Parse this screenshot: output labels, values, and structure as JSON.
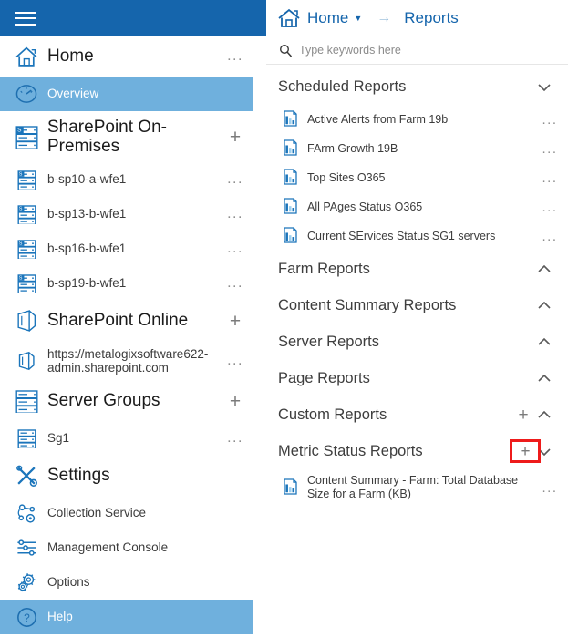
{
  "sidebar": {
    "menu_icon": "hamburger-icon",
    "items": [
      {
        "id": "home",
        "label": "Home",
        "icon": "home-icon",
        "type": "top",
        "action": "...",
        "selected": false
      },
      {
        "id": "overview",
        "label": "Overview",
        "icon": "gauge-icon",
        "type": "child",
        "action": "",
        "selected": true
      },
      {
        "id": "sp-onprem",
        "label": "SharePoint On-Premises",
        "icon": "server-sp-icon",
        "type": "group-two",
        "action": "+",
        "selected": false
      },
      {
        "id": "b-sp10-a-wfe1",
        "label": "b-sp10-a-wfe1",
        "icon": "server-sp-small-icon",
        "type": "child",
        "action": "...",
        "selected": false
      },
      {
        "id": "b-sp13-b-wfe1",
        "label": "b-sp13-b-wfe1",
        "icon": "server-sp-small-icon",
        "type": "child",
        "action": "...",
        "selected": false
      },
      {
        "id": "b-sp16-b-wfe1",
        "label": "b-sp16-b-wfe1",
        "icon": "server-sp-small-icon",
        "type": "child",
        "action": "...",
        "selected": false
      },
      {
        "id": "b-sp19-b-wfe1",
        "label": "b-sp19-b-wfe1",
        "icon": "server-sp-small-icon",
        "type": "child",
        "action": "...",
        "selected": false
      },
      {
        "id": "sp-online",
        "label": "SharePoint Online",
        "icon": "sharepoint-online-icon",
        "type": "group",
        "action": "+",
        "selected": false
      },
      {
        "id": "sp-online-tenant",
        "label": "https://metalogixsoftware622-admin.sharepoint.com",
        "icon": "sharepoint-online-small-icon",
        "type": "child-two",
        "action": "...",
        "selected": false
      },
      {
        "id": "server-groups",
        "label": "Server Groups",
        "icon": "server-group-icon",
        "type": "group",
        "action": "+",
        "selected": false
      },
      {
        "id": "sg1",
        "label": "Sg1",
        "icon": "server-small-icon",
        "type": "child",
        "action": "...",
        "selected": false
      },
      {
        "id": "settings",
        "label": "Settings",
        "icon": "tools-icon",
        "type": "group",
        "action": "",
        "selected": false
      },
      {
        "id": "collection-service",
        "label": "Collection Service",
        "icon": "network-node-icon",
        "type": "child",
        "action": "",
        "selected": false
      },
      {
        "id": "management-console",
        "label": "Management Console",
        "icon": "sliders-icon",
        "type": "child",
        "action": "",
        "selected": false
      },
      {
        "id": "options",
        "label": "Options",
        "icon": "gears-icon",
        "type": "child",
        "action": "",
        "selected": false
      },
      {
        "id": "help",
        "label": "Help",
        "icon": "question-circle-icon",
        "type": "child",
        "action": "",
        "selected": true
      }
    ]
  },
  "breadcrumb": {
    "home_icon": "home-icon",
    "home_label": "Home",
    "dropdown_caret": "caret-down-icon",
    "separator": "arrow-right-icon",
    "current": "Reports"
  },
  "search": {
    "icon": "search-icon",
    "placeholder": "Type keywords here",
    "value": ""
  },
  "reports": {
    "sections": [
      {
        "id": "scheduled-reports",
        "title": "Scheduled Reports",
        "expanded": true,
        "chevron": "chevron-down-icon",
        "has_add": false,
        "add_highlighted": false,
        "items": [
          {
            "label": "Active Alerts from Farm 19b",
            "icon": "report-chart-icon",
            "action": "..."
          },
          {
            "label": "FArm Growth 19B",
            "icon": "report-chart-icon",
            "action": "..."
          },
          {
            "label": "Top Sites O365",
            "icon": "report-chart-icon",
            "action": "..."
          },
          {
            "label": "All PAges Status O365",
            "icon": "report-chart-icon",
            "action": "..."
          },
          {
            "label": "Current SErvices Status SG1 servers",
            "icon": "report-chart-icon",
            "action": "..."
          }
        ]
      },
      {
        "id": "farm-reports",
        "title": "Farm Reports",
        "expanded": false,
        "chevron": "chevron-up-icon",
        "has_add": false,
        "add_highlighted": false,
        "items": []
      },
      {
        "id": "content-summary-reports",
        "title": "Content Summary Reports",
        "expanded": false,
        "chevron": "chevron-up-icon",
        "has_add": false,
        "add_highlighted": false,
        "items": []
      },
      {
        "id": "server-reports",
        "title": "Server Reports",
        "expanded": false,
        "chevron": "chevron-up-icon",
        "has_add": false,
        "add_highlighted": false,
        "items": []
      },
      {
        "id": "page-reports",
        "title": "Page Reports",
        "expanded": false,
        "chevron": "chevron-up-icon",
        "has_add": false,
        "add_highlighted": false,
        "items": []
      },
      {
        "id": "custom-reports",
        "title": "Custom Reports",
        "expanded": false,
        "chevron": "chevron-up-icon",
        "has_add": true,
        "add_label": "+",
        "add_highlighted": false,
        "items": []
      },
      {
        "id": "metric-status-reports",
        "title": "Metric Status Reports",
        "expanded": true,
        "chevron": "chevron-down-icon",
        "has_add": true,
        "add_label": "+",
        "add_highlighted": true,
        "items": [
          {
            "label": "Content Summary - Farm: Total Database Size for a Farm (KB)",
            "icon": "report-chart-icon",
            "action": "...",
            "two_line": true
          }
        ]
      }
    ]
  },
  "colors": {
    "header_blue": "#1565ac",
    "selection_blue": "#6fb0dd",
    "icon_blue": "#1b75bb",
    "highlight_red": "#ee1b1b",
    "text_dark": "#2a2a2a",
    "text_muted": "#8d8d8d"
  }
}
